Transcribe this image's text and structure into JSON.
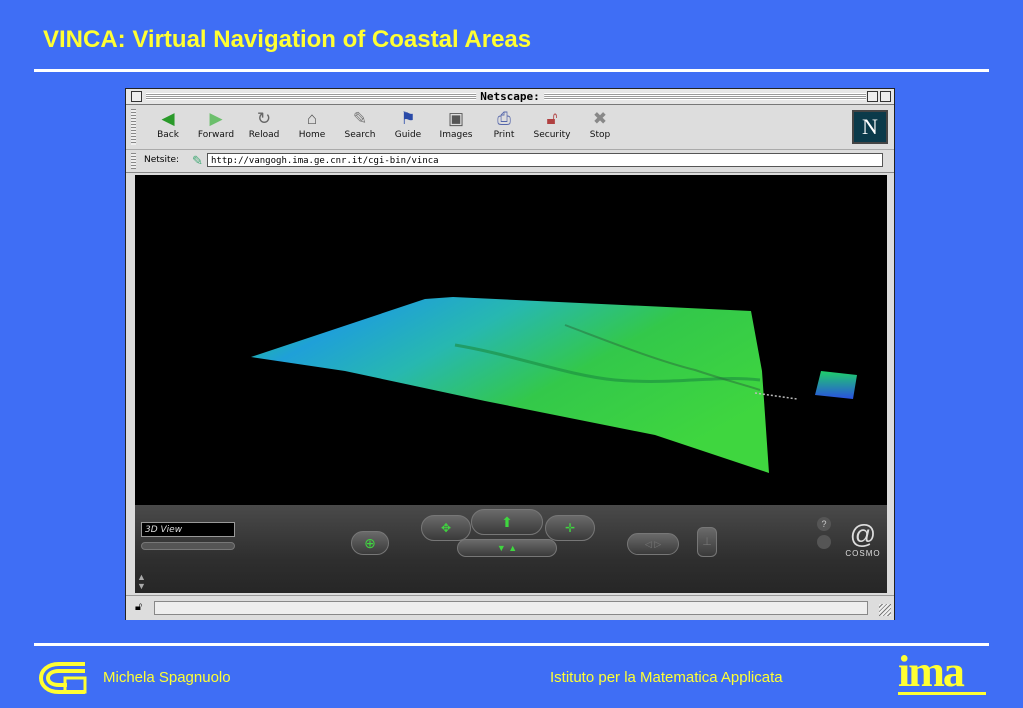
{
  "slide": {
    "title": "VINCA: Virtual Navigation of Coastal Areas",
    "author": "Michela Spagnuolo",
    "institute": "Istituto per la Matematica Applicata",
    "ima_logo_text": "ima"
  },
  "browser": {
    "window_title": "Netscape:",
    "logo_letter": "N",
    "toolbar": [
      {
        "label": "Back",
        "icon": "back-arrow-icon"
      },
      {
        "label": "Forward",
        "icon": "forward-arrow-icon"
      },
      {
        "label": "Reload",
        "icon": "reload-icon"
      },
      {
        "label": "Home",
        "icon": "home-icon"
      },
      {
        "label": "Search",
        "icon": "search-icon"
      },
      {
        "label": "Guide",
        "icon": "guide-icon"
      },
      {
        "label": "Images",
        "icon": "images-icon"
      },
      {
        "label": "Print",
        "icon": "print-icon"
      },
      {
        "label": "Security",
        "icon": "security-lock-icon"
      },
      {
        "label": "Stop",
        "icon": "stop-icon"
      }
    ],
    "location_label": "Netsite:",
    "url": "http://vangogh.ima.ge.cnr.it/cgi-bin/vinca"
  },
  "cosmo": {
    "view_name": "3D View",
    "brand": "COSMO",
    "help": "?"
  },
  "colors": {
    "slide_background": "#3f6ef5",
    "title_text": "#ffff33",
    "terrain_green": "#3fd63f",
    "terrain_blue": "#2a78e0"
  }
}
